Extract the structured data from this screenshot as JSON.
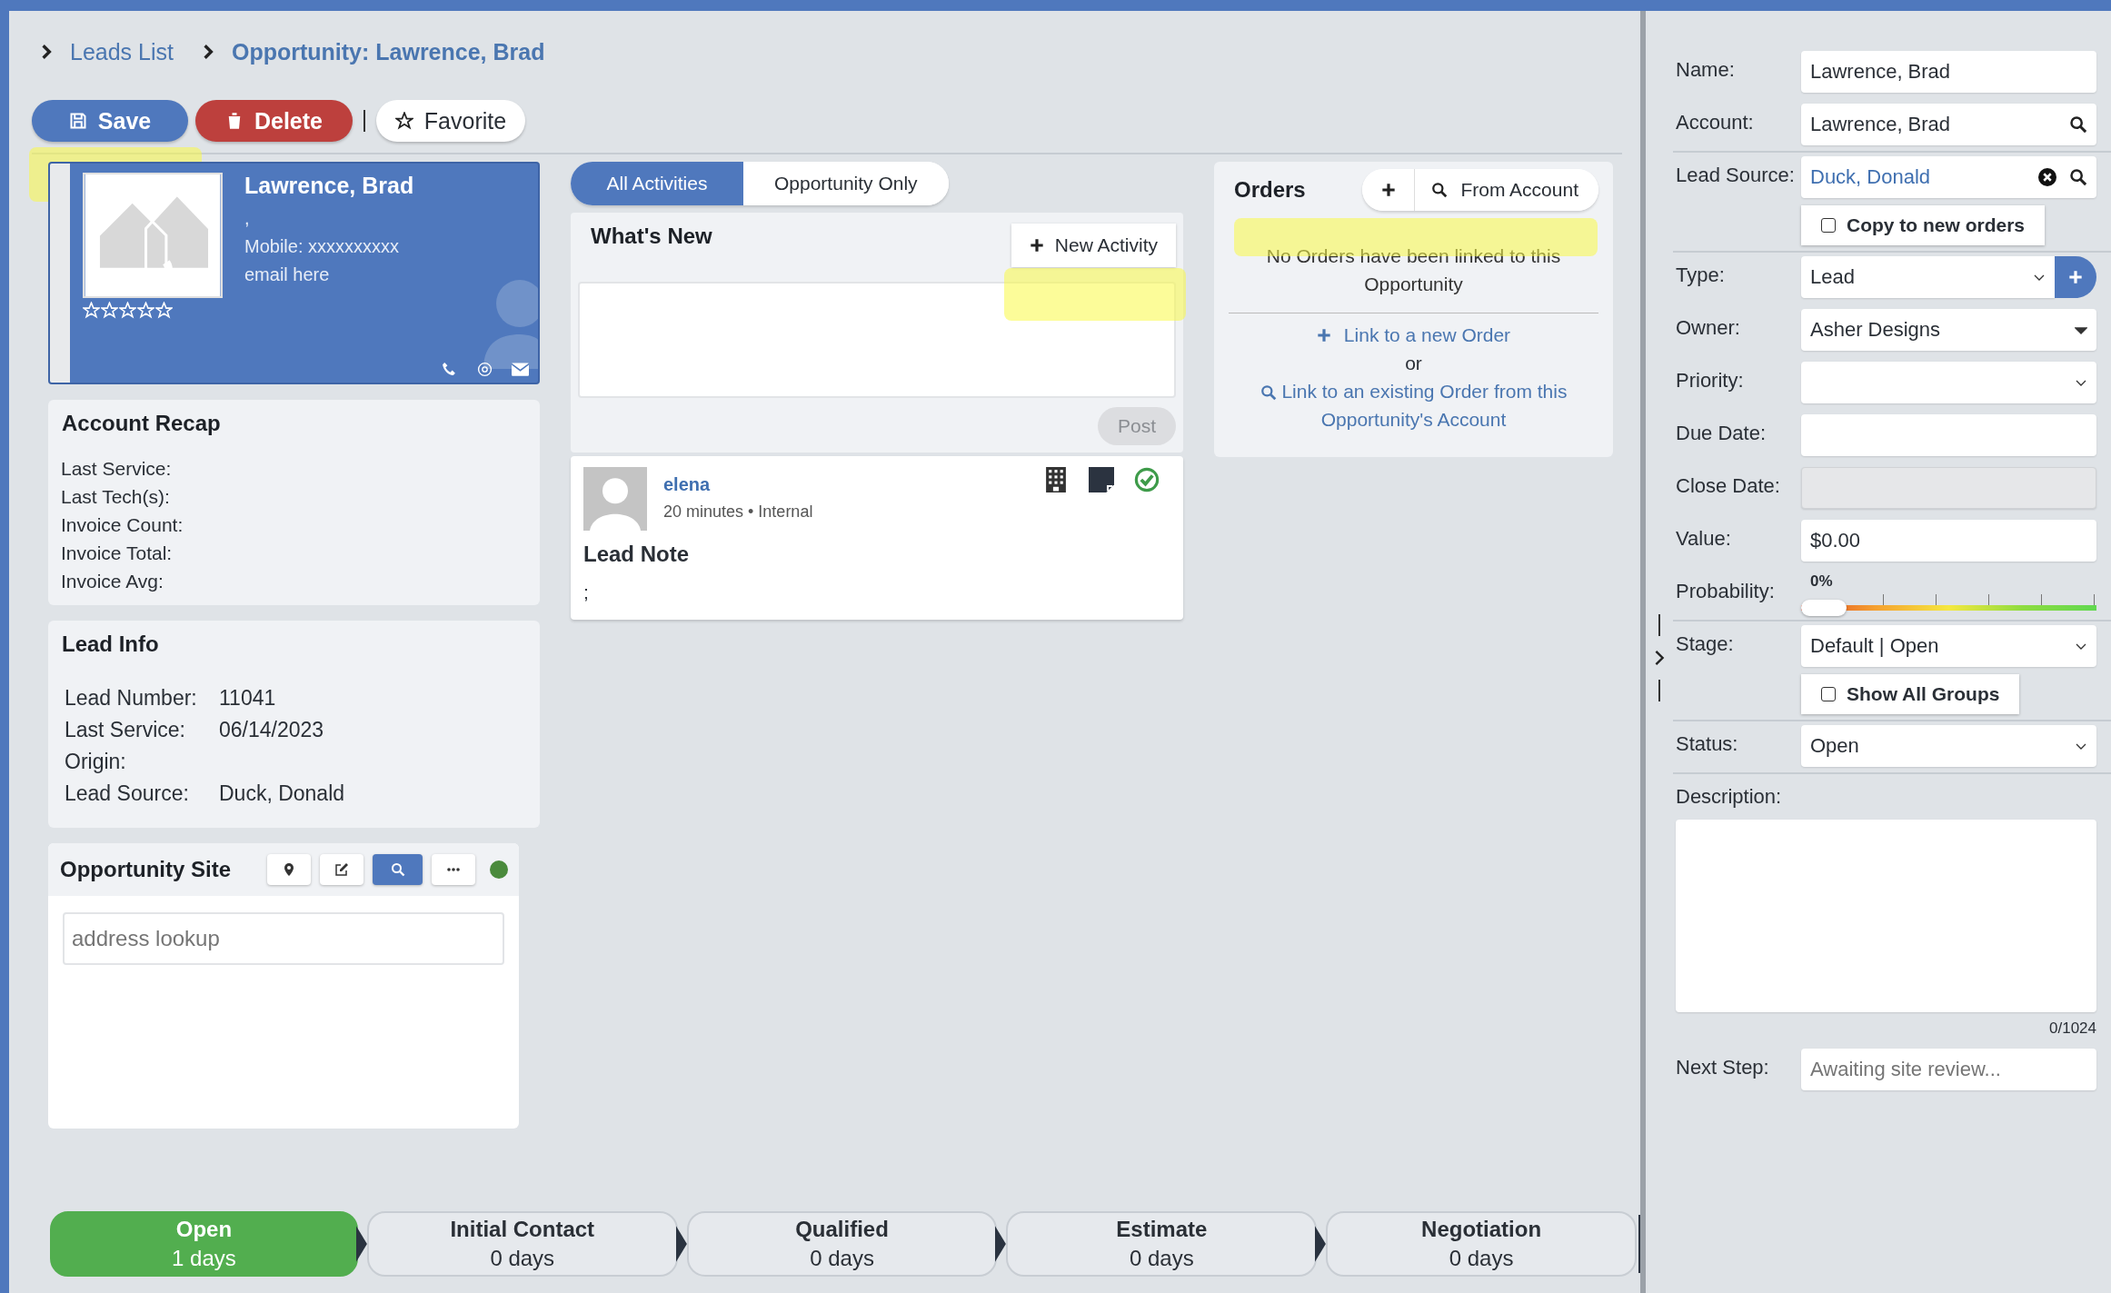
{
  "breadcrumb": [
    {
      "label": "Leads List",
      "current": false
    },
    {
      "label": "Opportunity: Lawrence, Brad",
      "current": true
    }
  ],
  "actions": [
    {
      "label": "Save",
      "kind": "save"
    },
    {
      "label": "Delete",
      "kind": "delete"
    },
    {
      "label": "Favorite",
      "kind": "favorite"
    }
  ],
  "contact_card": {
    "name": "Lawrence, Brad",
    "line_2": ",",
    "mobile": "Mobile: xxxxxxxxxx",
    "email": "email here",
    "stars": 0
  },
  "account_recap": {
    "title": "Account Recap",
    "fields": [
      "Last Service:",
      "Last Tech(s):",
      "Invoice Count:",
      "Invoice Total:",
      "Invoice Avg:"
    ]
  },
  "lead_info": {
    "title": "Lead Info",
    "fields": [
      {
        "label": "Lead Number:",
        "value": "11041"
      },
      {
        "label": "Last Service:",
        "value": "06/14/2023"
      },
      {
        "label": "Origin:"
      },
      {
        "label": "Lead Source:",
        "value": "Duck, Donald"
      }
    ]
  },
  "opportunity_site": {
    "title": "Opportunity Site",
    "tools": [
      {
        "kind": "pin",
        "selected": false
      },
      {
        "kind": "edit",
        "selected": false
      },
      {
        "kind": "search",
        "selected": true
      },
      {
        "kind": "more",
        "selected": false
      }
    ],
    "color": "#4a8a3c",
    "placeholder": "address lookup"
  },
  "activity_tabs": [
    {
      "label": "All Activities",
      "selected": true
    },
    {
      "label": "Opportunity Only",
      "selected": false
    }
  ],
  "whats_new": {
    "title": "What's New",
    "new_button": "New Activity",
    "post_button": "Post",
    "post_disabled": true
  },
  "activities": [
    {
      "author": "elena",
      "meta": "20 minutes • Internal",
      "title": "Lead Note",
      "body": ";",
      "done": true
    }
  ],
  "orders": {
    "title": "Orders",
    "from_account": "From Account",
    "empty_message": "No Orders have been linked to this Opportunity",
    "link_new": "Link to a new Order",
    "or": "or",
    "link_existing": "Link to an existing Order from this Opportunity's Account"
  },
  "detail_groups": [
    [
      {
        "kind": "text",
        "label": "Name:",
        "value": "Lawrence, Brad"
      },
      {
        "kind": "lookup",
        "label": "Account:",
        "value": "Lawrence, Brad",
        "linked": false
      }
    ],
    [
      {
        "kind": "lookup",
        "label": "Lead Source:",
        "value": "Duck, Donald",
        "linked": true,
        "clearable": true,
        "checkbox": {
          "label": "Copy to new orders",
          "checked": false
        }
      }
    ],
    [
      {
        "kind": "select",
        "label": "Type:",
        "value": "Lead",
        "filled_caret": false,
        "add_button": true
      },
      {
        "kind": "select",
        "label": "Owner:",
        "value": "Asher Designs",
        "filled_caret": true
      },
      {
        "kind": "select",
        "label": "Priority:",
        "filled_caret": false
      },
      {
        "kind": "text",
        "label": "Due Date:"
      },
      {
        "kind": "text",
        "label": "Close Date:",
        "disabled": true
      },
      {
        "kind": "text",
        "label": "Value:",
        "value": "$0.00"
      },
      {
        "kind": "slider",
        "label": "Probability:",
        "reading": "0%",
        "level": 0
      }
    ],
    [
      {
        "kind": "select",
        "label": "Stage:",
        "value": "Default | Open",
        "filled_caret": false,
        "checkbox": {
          "label": "Show All Groups",
          "checked": false
        }
      }
    ],
    [
      {
        "kind": "select",
        "label": "Status:",
        "value": "Open",
        "filled_caret": false
      }
    ],
    [
      {
        "kind": "textarea",
        "label": "Description:",
        "counter": "0/1024"
      },
      {
        "kind": "text",
        "label": "Next Step:",
        "placeholder": "Awaiting site review..."
      }
    ]
  ],
  "stages": [
    {
      "name": "Open",
      "duration": "1 days",
      "selected": true
    },
    {
      "name": "Initial Contact",
      "duration": "0 days",
      "selected": false
    },
    {
      "name": "Qualified",
      "duration": "0 days",
      "selected": false
    },
    {
      "name": "Estimate",
      "duration": "0 days",
      "selected": false
    },
    {
      "name": "Negotiation",
      "duration": "0 days",
      "selected": false
    }
  ]
}
